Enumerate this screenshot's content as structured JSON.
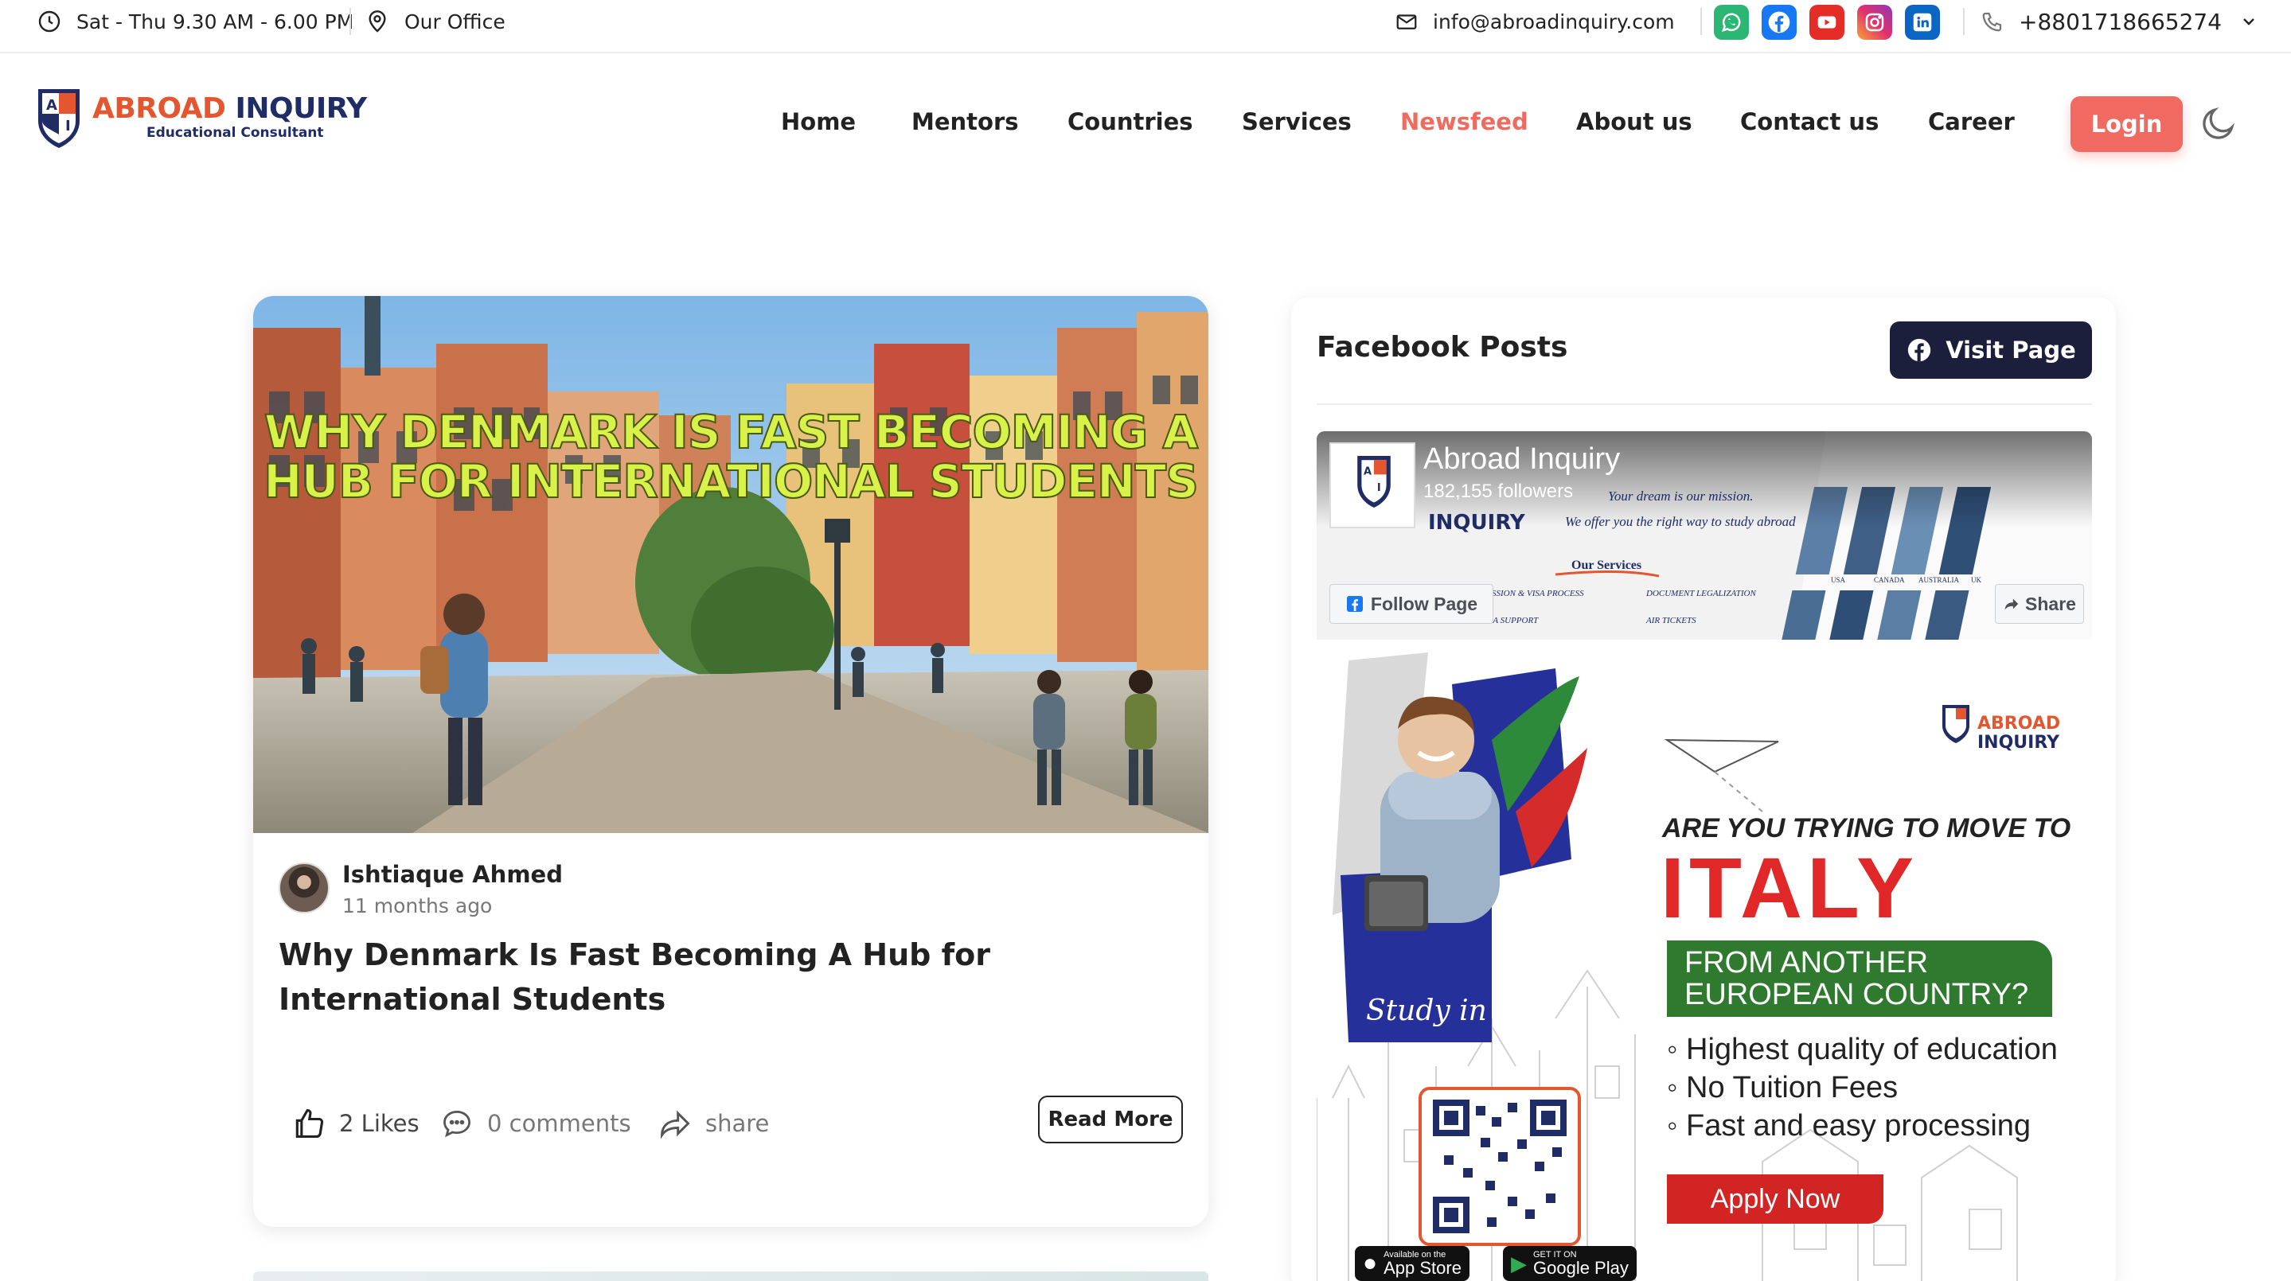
{
  "topbar": {
    "hours": "Sat - Thu 9.30 AM - 6.00 PM",
    "office": "Our Office",
    "email": "info@abroadinquiry.com",
    "phone": "+8801718665274",
    "social_icons": [
      "whatsapp-icon",
      "facebook-icon",
      "youtube-icon",
      "instagram-icon",
      "linkedin-icon"
    ]
  },
  "brand": {
    "name_part1": "ABROAD",
    "name_part2": "INQUIRY",
    "tagline": "Educational Consultant",
    "accent_color": "#e3562f",
    "navy_color": "#1f2c66"
  },
  "nav": {
    "items": [
      "Home",
      "Mentors",
      "Countries",
      "Services",
      "Newsfeed",
      "About us",
      "Contact us",
      "Career"
    ],
    "active": "Newsfeed",
    "active_color": "#ee6b5f",
    "login_label": "Login",
    "login_color": "#f06a62"
  },
  "post": {
    "image_headline_line1": "WHY DENMARK IS FAST BECOMING A",
    "image_headline_line2": "HUB FOR INTERNATIONAL STUDENTS",
    "author": "Ishtiaque Ahmed",
    "time": "11 months ago",
    "title": "Why Denmark Is Fast Becoming A Hub for International Students",
    "likes": "2 Likes",
    "comments": "0 comments",
    "share": "share",
    "read_more": "Read More"
  },
  "facebook": {
    "heading": "Facebook Posts",
    "visit_label": "Visit Page",
    "page_name": "Abroad Inquiry",
    "followers": "182,155 followers",
    "follow_label": "Follow Page",
    "share_label": "Share",
    "cover": {
      "brand": "INQUIRY",
      "slogan1": "Your dream is our mission.",
      "slogan2": "We offer you the right way to study abroad",
      "services_title": "Our Services",
      "service1": "SSION & VISA PROCESS",
      "service2": "DOCUMENT LEGALIZATION",
      "service3": "R VISA SUPPORT",
      "service4": "AIR TICKETS",
      "countries": [
        "USA",
        "CANADA",
        "AUSTRALIA",
        "UK"
      ]
    },
    "ad": {
      "brand_line1": "ABROAD",
      "brand_line2": "INQUIRY",
      "question": "ARE YOU TRYING TO MOVE TO",
      "country": "ITALY",
      "from_line1": "FROM ANOTHER",
      "from_line2": "EUROPEAN COUNTRY?",
      "bullets": [
        "Highest quality of education",
        "No Tuition Fees",
        "Fast and easy processing"
      ],
      "apply": "Apply Now",
      "study_in": "Study in",
      "app_store_small": "Available on the",
      "app_store": "App Store",
      "play_small": "GET IT ON",
      "play": "Google Play"
    }
  }
}
